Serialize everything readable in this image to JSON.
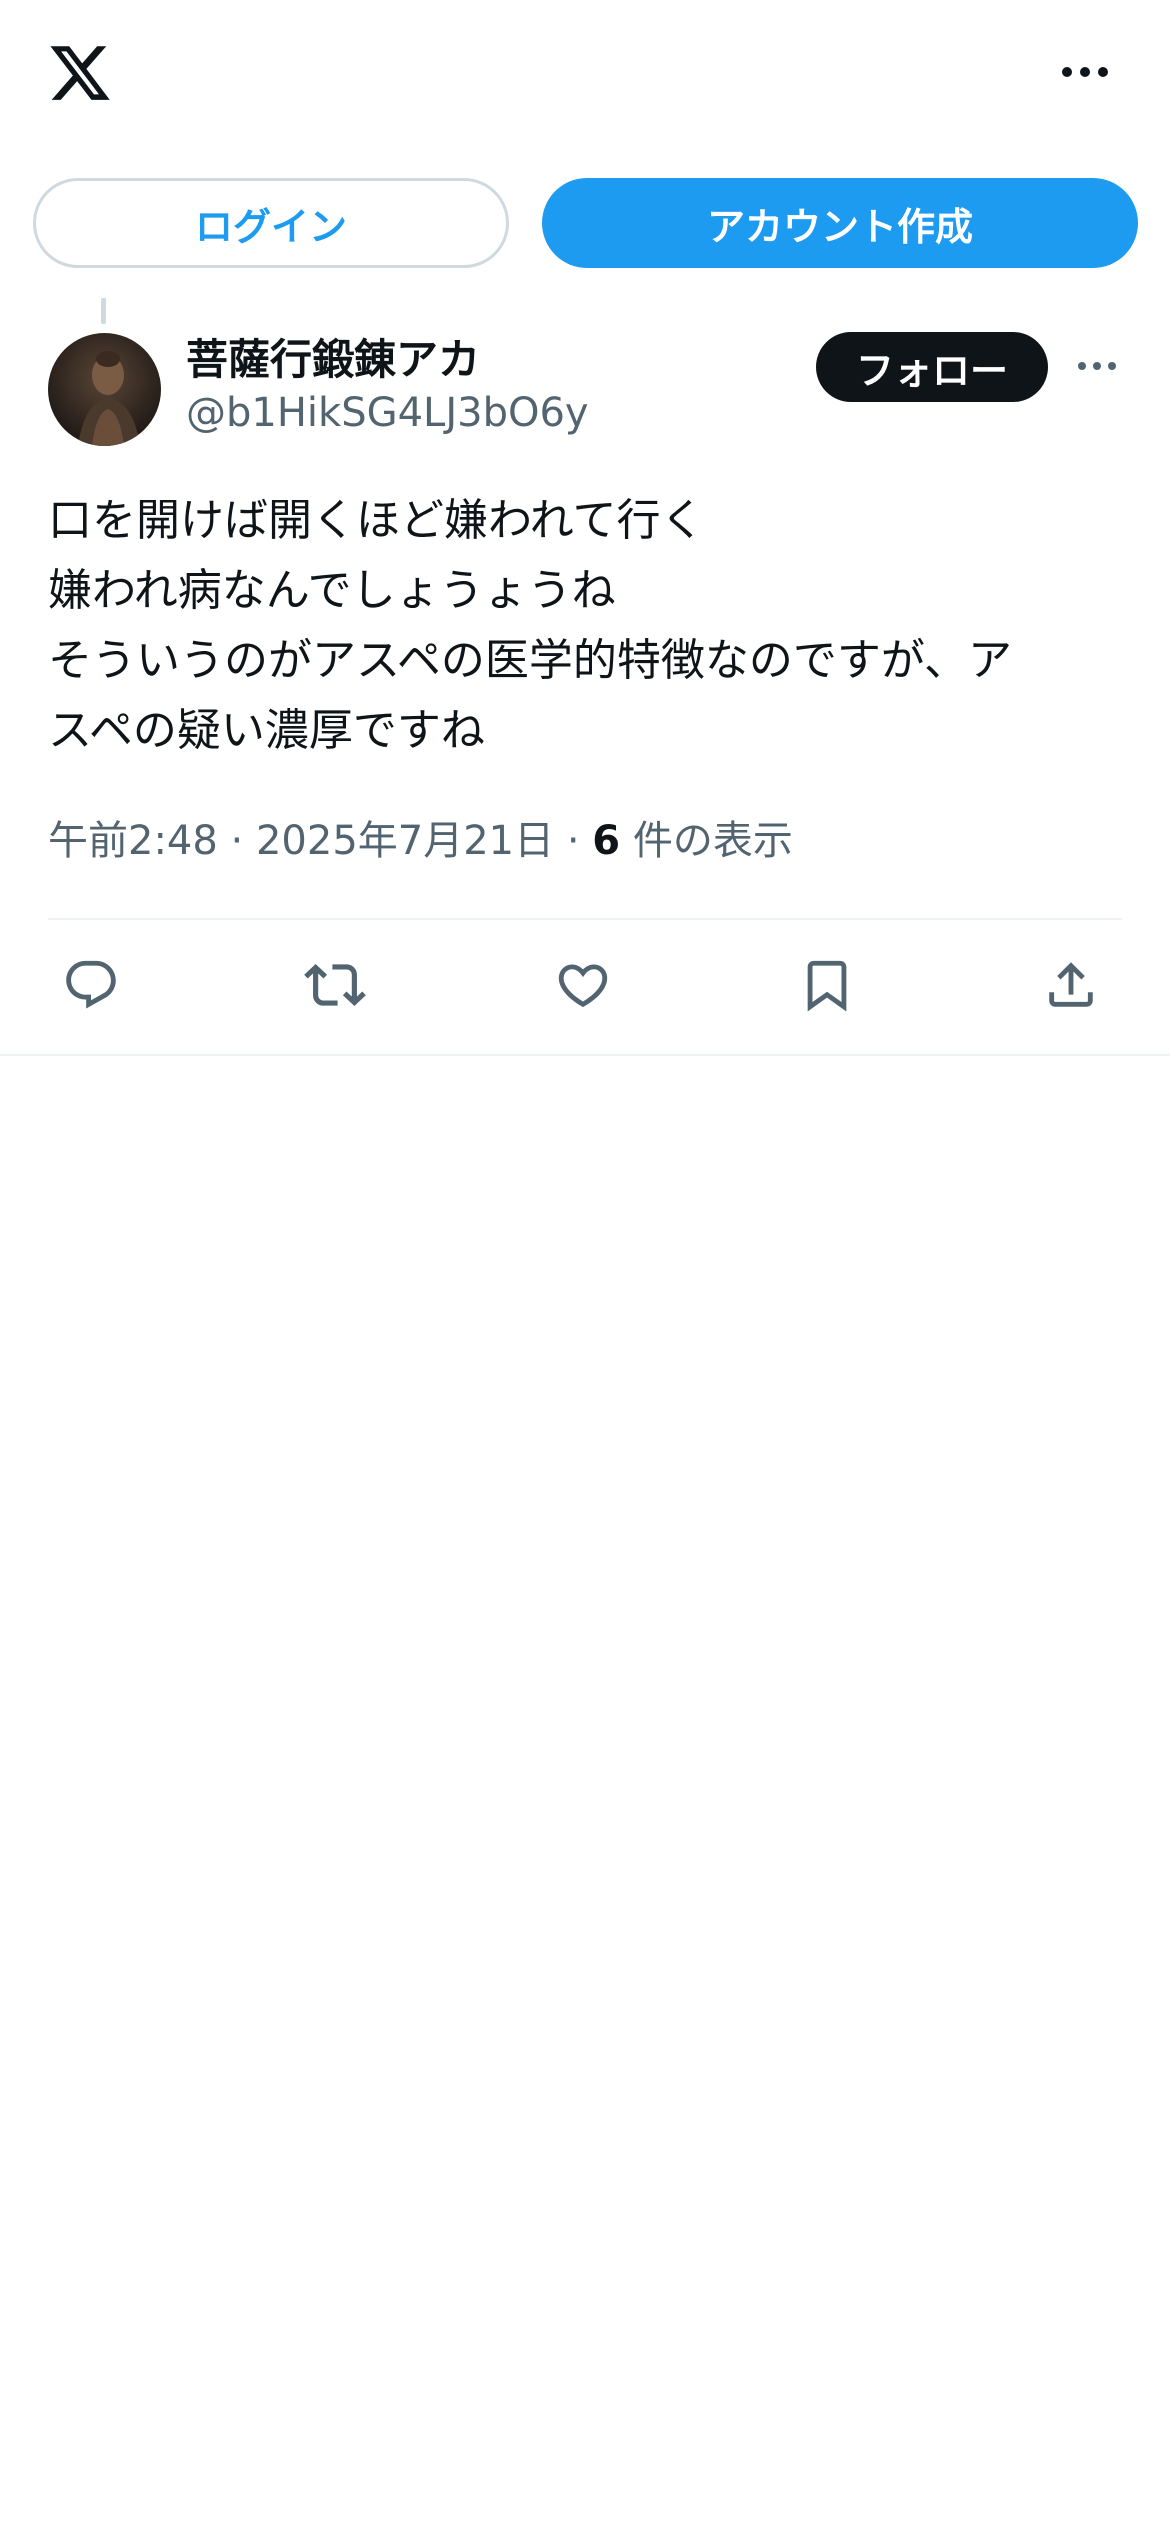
{
  "header": {
    "logo_icon": "x-logo-icon",
    "more_icon": "more-horizontal-icon"
  },
  "auth": {
    "login_label": "ログイン",
    "create_account_label": "アカウント作成"
  },
  "tweet": {
    "author_name": "菩薩行鍛錬アカ",
    "author_handle": "@b1HikSG4LJ3bO6y",
    "follow_label": "フォロー",
    "text_lines": [
      "口を開けば開くほど嫌われて行く",
      "嫌われ病なんでしょうょうね",
      "そういうのがアスペの医学的特徴なのですが、ア",
      "スペの疑い濃厚ですね"
    ],
    "time": "午前2:48",
    "separator": "·",
    "date": "2025年7月21日",
    "views_count": "6",
    "views_label": "件の表示"
  },
  "actions": {
    "reply_icon": "reply-icon",
    "retweet_icon": "retweet-icon",
    "like_icon": "like-icon",
    "bookmark_icon": "bookmark-icon",
    "share_icon": "share-icon"
  },
  "colors": {
    "accent": "#1d9bf0",
    "text": "#0f1419",
    "secondary": "#536471",
    "border": "#cfd9de",
    "divider": "#eff3f4"
  }
}
